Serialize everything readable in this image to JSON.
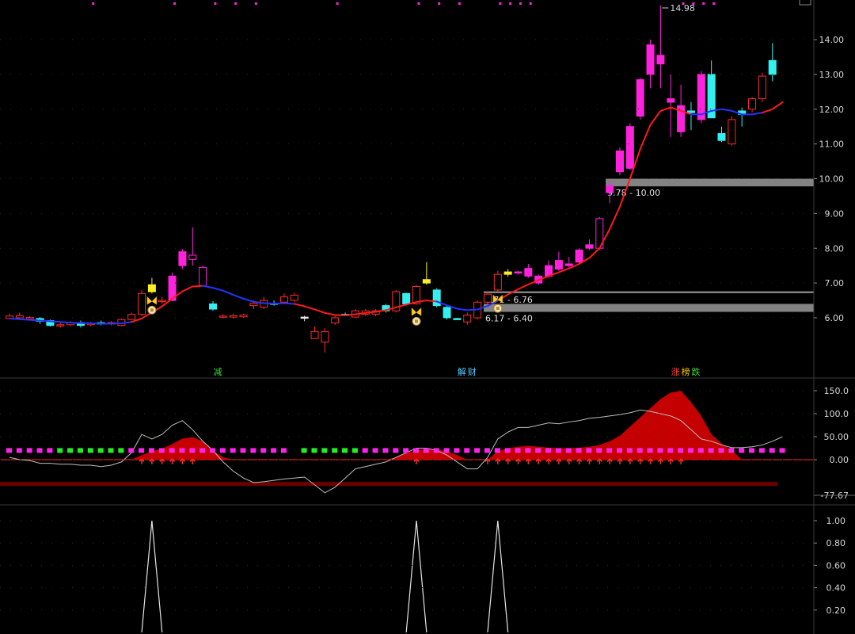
{
  "chart_data": [
    {
      "type": "candlestick",
      "title": "",
      "ylim": [
        5.0,
        15.2
      ],
      "y_ticks": [
        "14.00",
        "13.00",
        "12.00",
        "11.00",
        "10.00",
        "9.00",
        "8.00",
        "7.00",
        "6.00"
      ],
      "y_tick_values": [
        14,
        13,
        12,
        11,
        10,
        9,
        8,
        7,
        6
      ],
      "candles": [
        {
          "o": 6.05,
          "h": 6.12,
          "l": 5.95,
          "c": 5.98,
          "col": "red"
        },
        {
          "o": 6.0,
          "h": 6.15,
          "l": 5.95,
          "c": 6.06,
          "col": "red"
        },
        {
          "o": 5.97,
          "h": 6.05,
          "l": 5.92,
          "c": 6.01,
          "col": "red"
        },
        {
          "o": 5.98,
          "h": 6.02,
          "l": 5.82,
          "c": 5.9,
          "col": "cyan"
        },
        {
          "o": 5.92,
          "h": 5.95,
          "l": 5.75,
          "c": 5.78,
          "col": "cyan"
        },
        {
          "o": 5.78,
          "h": 5.86,
          "l": 5.72,
          "c": 5.8,
          "col": "red"
        },
        {
          "o": 5.8,
          "h": 5.9,
          "l": 5.76,
          "c": 5.86,
          "col": "red"
        },
        {
          "o": 5.86,
          "h": 5.92,
          "l": 5.72,
          "c": 5.78,
          "col": "cyan"
        },
        {
          "o": 5.8,
          "h": 5.88,
          "l": 5.76,
          "c": 5.84,
          "col": "red"
        },
        {
          "o": 5.86,
          "h": 5.92,
          "l": 5.78,
          "c": 5.82,
          "col": "cyan"
        },
        {
          "o": 5.82,
          "h": 5.9,
          "l": 5.78,
          "c": 5.86,
          "col": "red"
        },
        {
          "o": 5.78,
          "h": 5.98,
          "l": 5.76,
          "c": 5.95,
          "col": "red"
        },
        {
          "o": 5.95,
          "h": 6.15,
          "l": 5.92,
          "c": 6.1,
          "col": "red"
        },
        {
          "o": 6.1,
          "h": 6.8,
          "l": 6.05,
          "c": 6.7,
          "col": "red"
        },
        {
          "o": 6.75,
          "h": 7.15,
          "l": 6.7,
          "c": 6.95,
          "col": "yellow"
        },
        {
          "o": 6.5,
          "h": 6.6,
          "l": 6.4,
          "c": 6.5,
          "col": "red"
        },
        {
          "o": 6.5,
          "h": 7.3,
          "l": 6.48,
          "c": 7.2,
          "col": "magenta"
        },
        {
          "o": 7.5,
          "h": 7.98,
          "l": 7.4,
          "c": 7.9,
          "col": "magenta"
        },
        {
          "o": 7.8,
          "h": 8.6,
          "l": 7.5,
          "c": 7.68,
          "col": "magenta_open"
        },
        {
          "o": 7.45,
          "h": 7.5,
          "l": 6.9,
          "c": 6.92,
          "col": "magenta_open"
        },
        {
          "o": 6.4,
          "h": 6.48,
          "l": 6.2,
          "c": 6.25,
          "col": "cyan"
        },
        {
          "o": 6.05,
          "h": 6.1,
          "l": 5.98,
          "c": 6.02,
          "col": "red"
        },
        {
          "o": 6.02,
          "h": 6.12,
          "l": 5.98,
          "c": 6.06,
          "col": "red"
        },
        {
          "o": 6.03,
          "h": 6.12,
          "l": 6.0,
          "c": 6.08,
          "col": "red"
        },
        {
          "o": 6.35,
          "h": 6.5,
          "l": 6.25,
          "c": 6.42,
          "col": "red"
        },
        {
          "o": 6.3,
          "h": 6.6,
          "l": 6.25,
          "c": 6.5,
          "col": "red"
        },
        {
          "o": 6.4,
          "h": 6.5,
          "l": 6.35,
          "c": 6.42,
          "col": "cyan"
        },
        {
          "o": 6.45,
          "h": 6.7,
          "l": 6.4,
          "c": 6.6,
          "col": "red"
        },
        {
          "o": 6.5,
          "h": 6.72,
          "l": 6.45,
          "c": 6.65,
          "col": "red"
        },
        {
          "o": 6.02,
          "h": 6.06,
          "l": 5.9,
          "c": 6.0,
          "col": "white"
        },
        {
          "o": 5.6,
          "h": 5.75,
          "l": 5.5,
          "c": 5.4,
          "col": "red"
        },
        {
          "o": 5.3,
          "h": 5.7,
          "l": 5.0,
          "c": 5.6,
          "col": "red"
        },
        {
          "o": 5.85,
          "h": 6.05,
          "l": 5.8,
          "c": 6.0,
          "col": "red"
        },
        {
          "o": 6.1,
          "h": 6.15,
          "l": 6.05,
          "c": 6.1,
          "col": "cyan"
        },
        {
          "o": 6.02,
          "h": 6.25,
          "l": 6.0,
          "c": 6.2,
          "col": "red"
        },
        {
          "o": 6.1,
          "h": 6.25,
          "l": 6.05,
          "c": 6.2,
          "col": "red"
        },
        {
          "o": 6.1,
          "h": 6.25,
          "l": 6.05,
          "c": 6.2,
          "col": "red"
        },
        {
          "o": 6.35,
          "h": 6.4,
          "l": 6.15,
          "c": 6.2,
          "col": "cyan"
        },
        {
          "o": 6.2,
          "h": 6.8,
          "l": 6.15,
          "c": 6.75,
          "col": "red"
        },
        {
          "o": 6.7,
          "h": 6.72,
          "l": 6.35,
          "c": 6.4,
          "col": "cyan"
        },
        {
          "o": 6.4,
          "h": 6.95,
          "l": 6.38,
          "c": 6.9,
          "col": "red"
        },
        {
          "o": 7.0,
          "h": 7.6,
          "l": 6.95,
          "c": 7.1,
          "col": "yellow"
        },
        {
          "o": 6.8,
          "h": 6.85,
          "l": 6.3,
          "c": 6.35,
          "col": "cyan"
        },
        {
          "o": 6.3,
          "h": 6.35,
          "l": 5.95,
          "c": 6.0,
          "col": "cyan"
        },
        {
          "o": 5.98,
          "h": 6.0,
          "l": 5.95,
          "c": 5.97,
          "col": "cyan"
        },
        {
          "o": 5.88,
          "h": 6.15,
          "l": 5.8,
          "c": 6.08,
          "col": "red"
        },
        {
          "o": 6.0,
          "h": 6.5,
          "l": 5.95,
          "c": 6.45,
          "col": "red"
        },
        {
          "o": 6.45,
          "h": 6.75,
          "l": 6.4,
          "c": 6.68,
          "col": "red"
        },
        {
          "o": 6.8,
          "h": 7.35,
          "l": 6.75,
          "c": 7.25,
          "col": "red"
        },
        {
          "o": 7.25,
          "h": 7.4,
          "l": 7.18,
          "c": 7.32,
          "col": "yellow"
        },
        {
          "o": 7.3,
          "h": 7.35,
          "l": 7.25,
          "c": 7.32,
          "col": "magenta"
        },
        {
          "o": 7.2,
          "h": 7.55,
          "l": 7.15,
          "c": 7.42,
          "col": "magenta"
        },
        {
          "o": 7.0,
          "h": 7.25,
          "l": 6.95,
          "c": 7.2,
          "col": "magenta"
        },
        {
          "o": 7.2,
          "h": 7.65,
          "l": 7.15,
          "c": 7.5,
          "col": "magenta"
        },
        {
          "o": 7.4,
          "h": 7.9,
          "l": 7.35,
          "c": 7.65,
          "col": "magenta"
        },
        {
          "o": 7.5,
          "h": 7.75,
          "l": 7.45,
          "c": 7.55,
          "col": "magenta"
        },
        {
          "o": 7.6,
          "h": 8.0,
          "l": 7.55,
          "c": 7.95,
          "col": "magenta"
        },
        {
          "o": 8.0,
          "h": 8.25,
          "l": 7.95,
          "c": 8.1,
          "col": "magenta"
        },
        {
          "o": 8.0,
          "h": 8.9,
          "l": 7.95,
          "c": 8.85,
          "col": "magenta_open"
        },
        {
          "o": 9.6,
          "h": 9.95,
          "l": 9.3,
          "c": 9.8,
          "col": "magenta"
        },
        {
          "o": 10.2,
          "h": 10.9,
          "l": 10.1,
          "c": 10.8,
          "col": "magenta"
        },
        {
          "o": 10.3,
          "h": 11.6,
          "l": 10.25,
          "c": 11.5,
          "col": "magenta"
        },
        {
          "o": 11.8,
          "h": 12.9,
          "l": 11.7,
          "c": 12.85,
          "col": "magenta"
        },
        {
          "o": 13.0,
          "h": 14.0,
          "l": 12.6,
          "c": 13.85,
          "col": "magenta"
        },
        {
          "o": 13.55,
          "h": 14.98,
          "l": 12.6,
          "c": 13.3,
          "col": "magenta"
        },
        {
          "o": 12.3,
          "h": 13.0,
          "l": 11.2,
          "c": 12.2,
          "col": "magenta"
        },
        {
          "o": 12.1,
          "h": 12.7,
          "l": 11.2,
          "c": 11.35,
          "col": "magenta"
        },
        {
          "o": 11.95,
          "h": 12.2,
          "l": 11.4,
          "c": 11.9,
          "col": "cyan"
        },
        {
          "o": 11.7,
          "h": 13.1,
          "l": 11.6,
          "c": 13.0,
          "col": "magenta"
        },
        {
          "o": 13.0,
          "h": 13.4,
          "l": 11.75,
          "c": 11.75,
          "col": "cyan"
        },
        {
          "o": 11.3,
          "h": 11.5,
          "l": 11.05,
          "c": 11.1,
          "col": "cyan"
        },
        {
          "o": 11.0,
          "h": 11.8,
          "l": 10.95,
          "c": 11.7,
          "col": "red"
        },
        {
          "o": 11.95,
          "h": 12.05,
          "l": 11.5,
          "c": 11.85,
          "col": "cyan"
        },
        {
          "o": 12.0,
          "h": 12.35,
          "l": 11.9,
          "c": 12.3,
          "col": "red"
        },
        {
          "o": 12.3,
          "h": 13.05,
          "l": 12.2,
          "c": 12.95,
          "col": "red"
        },
        {
          "o": 13.4,
          "h": 13.9,
          "l": 12.8,
          "c": 13.0,
          "col": "cyan"
        }
      ],
      "ma_line": [
        5.98,
        5.96,
        5.94,
        5.92,
        5.9,
        5.88,
        5.86,
        5.85,
        5.84,
        5.83,
        5.83,
        5.84,
        5.88,
        5.98,
        6.15,
        6.33,
        6.55,
        6.76,
        6.9,
        6.92,
        6.86,
        6.78,
        6.66,
        6.55,
        6.46,
        6.42,
        6.41,
        6.42,
        6.4,
        6.33,
        6.24,
        6.14,
        6.08,
        6.07,
        6.1,
        6.14,
        6.17,
        6.22,
        6.3,
        6.38,
        6.45,
        6.5,
        6.47,
        6.36,
        6.26,
        6.22,
        6.24,
        6.34,
        6.5,
        6.67,
        6.82,
        6.96,
        7.08,
        7.2,
        7.31,
        7.42,
        7.55,
        7.72,
        8.0,
        8.55,
        9.2,
        10.0,
        10.85,
        11.55,
        11.95,
        12.05,
        11.95,
        11.85,
        11.85,
        11.95,
        12.0,
        11.95,
        11.85,
        11.85,
        11.9,
        12.0,
        12.2
      ],
      "ma_blue_ranges": [
        [
          0,
          12
        ],
        [
          19,
          28
        ],
        [
          42,
          48
        ],
        [
          67,
          74
        ]
      ],
      "zones": [
        {
          "label": "9.78 - 10.00",
          "low": 9.78,
          "high": 10.0,
          "from_index": 59,
          "color": "#9a9a9a"
        },
        {
          "label": "6.71 - 6.76",
          "low": 6.71,
          "high": 6.76,
          "from_index": 47,
          "color": "#a8a8a8"
        },
        {
          "label": "6.17 - 6.40",
          "low": 6.17,
          "high": 6.4,
          "from_index": 47,
          "color": "#9a9a9a"
        }
      ],
      "max_label": "14.98",
      "max_index": 64,
      "signals": [
        {
          "text": "减",
          "index": 20,
          "color": "#33dd33"
        },
        {
          "text": "解",
          "index": 44,
          "color": "#55ccff"
        },
        {
          "text": "财",
          "index": 45,
          "color": "#55ccff"
        },
        {
          "text": "涨",
          "index": 65,
          "color": "#ff4444"
        },
        {
          "text": "榜",
          "index": 66,
          "color": "#ffcc00"
        },
        {
          "text": "跌",
          "index": 67,
          "color": "#33dd33"
        }
      ],
      "markers": [
        14,
        40,
        48
      ],
      "top_dot_indices": [
        5,
        13,
        17,
        19,
        21,
        29,
        37,
        39,
        41,
        45,
        46,
        47,
        48,
        63,
        64,
        65,
        66
      ]
    },
    {
      "type": "area",
      "ylim": [
        -100,
        160
      ],
      "y_ticks": [
        "150.0",
        "100.0",
        "50.00",
        "0.00",
        "-77.67"
      ],
      "y_tick_values": [
        150,
        100,
        50,
        0,
        -77.67
      ],
      "red_area": [
        0,
        0,
        0,
        0,
        0,
        0,
        0,
        0,
        0,
        0,
        0,
        0,
        0,
        10,
        18,
        24,
        34,
        46,
        49,
        40,
        20,
        5,
        0,
        0,
        0,
        0,
        0,
        0,
        0,
        0,
        0,
        0,
        0,
        0,
        0,
        0,
        0,
        0,
        5,
        14,
        20,
        24,
        22,
        18,
        10,
        0,
        0,
        0,
        18,
        25,
        28,
        30,
        28,
        26,
        25,
        25,
        26,
        28,
        32,
        40,
        52,
        72,
        92,
        112,
        132,
        146,
        150,
        125,
        95,
        55,
        35,
        20,
        0,
        0,
        0,
        0,
        0
      ],
      "gray_line": [
        5,
        0,
        -2,
        -8,
        -8,
        -10,
        -10,
        -12,
        -12,
        -15,
        -12,
        -5,
        15,
        55,
        45,
        55,
        75,
        85,
        65,
        40,
        20,
        -5,
        -25,
        -40,
        -50,
        -48,
        -45,
        -42,
        -40,
        -38,
        -55,
        -72,
        -60,
        -40,
        -20,
        -15,
        -10,
        -5,
        5,
        15,
        25,
        25,
        20,
        10,
        -5,
        -20,
        -20,
        5,
        45,
        60,
        70,
        70,
        75,
        80,
        78,
        82,
        85,
        90,
        92,
        95,
        98,
        102,
        108,
        105,
        100,
        95,
        85,
        65,
        45,
        40,
        32,
        26,
        26,
        28,
        32,
        40,
        50
      ],
      "baseline_band": -52,
      "magenta_ranges": [
        [
          0,
          4
        ],
        [
          12,
          27
        ],
        [
          35,
          76
        ]
      ],
      "green_ranges": [
        [
          5,
          11
        ],
        [
          29,
          34
        ]
      ],
      "arrow_ranges": [
        [
          13,
          18
        ],
        [
          40,
          40
        ],
        [
          47,
          66
        ]
      ]
    },
    {
      "type": "line",
      "ylim": [
        0,
        1.1
      ],
      "y_ticks": [
        "1.00",
        "0.80",
        "0.60",
        "0.40",
        "0.20"
      ],
      "y_tick_values": [
        1.0,
        0.8,
        0.6,
        0.4,
        0.2
      ],
      "spikes": [
        14,
        40,
        48
      ]
    }
  ]
}
